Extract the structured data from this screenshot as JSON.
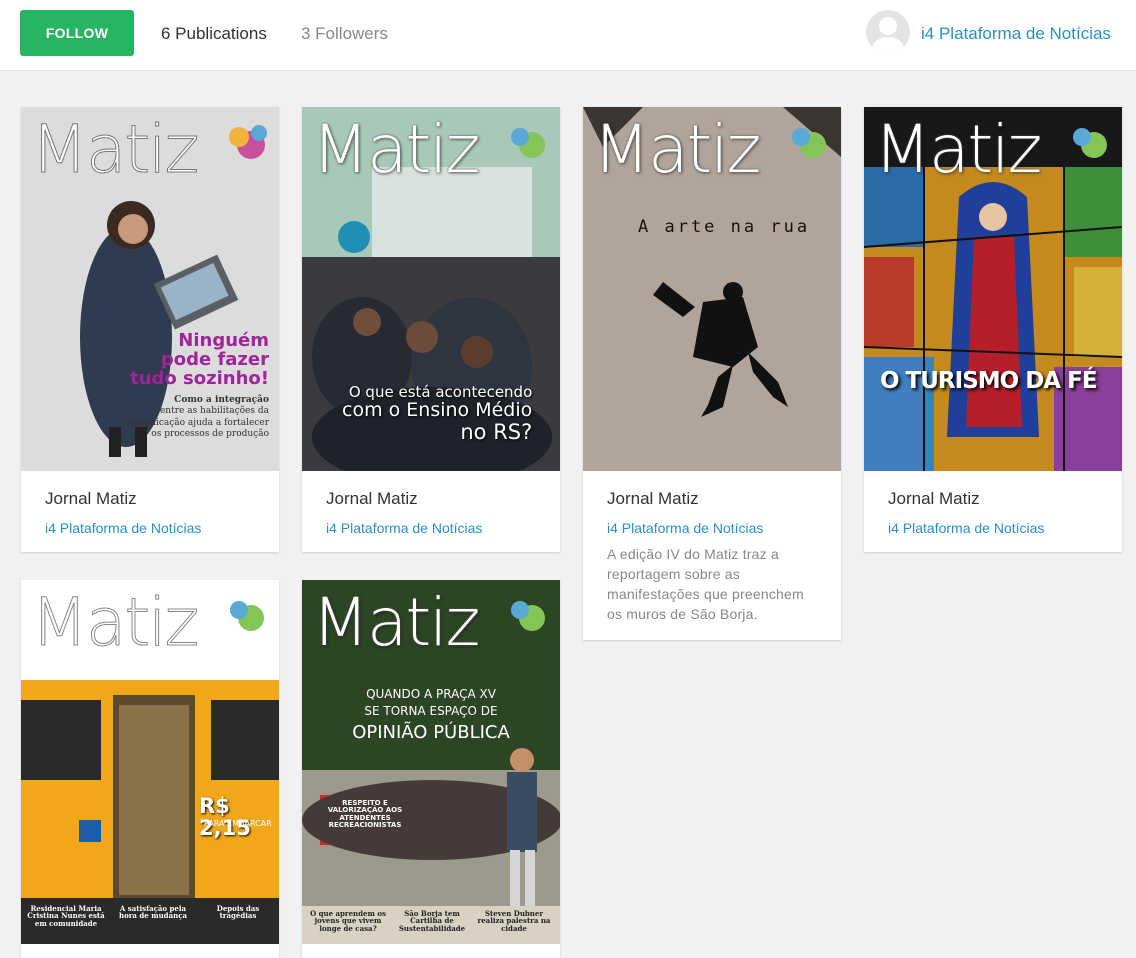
{
  "header": {
    "follow_label": "FOLLOW",
    "publications": "6 Publications",
    "followers": "3 Followers",
    "owner_name": "i4 Plataforma de Notícias"
  },
  "masthead": "Matiz",
  "cards": [
    {
      "title": "Jornal Matiz",
      "publisher": "i4 Plataforma de Notícias",
      "cover_text": [
        "Ninguém",
        "pode fazer",
        "tudo sozinho!",
        "Como a integração",
        "entre as habilitações da",
        "comunicação ajuda a fortalecer",
        "os processos de produção"
      ]
    },
    {
      "title": "Jornal Matiz",
      "publisher": "i4 Plataforma de Notícias",
      "cover_text": [
        "O que está acontecendo",
        "com o Ensino Médio",
        "no RS?"
      ]
    },
    {
      "title": "Jornal Matiz",
      "publisher": "i4 Plataforma de Notícias",
      "description": "A edição IV do Matiz traz a reportagem sobre as manifestações que preenchem os muros de São Borja.",
      "cover_text": [
        "A arte na rua"
      ]
    },
    {
      "title": "Jornal Matiz",
      "publisher": "i4 Plataforma de Notícias",
      "cover_text": [
        "O TURISMO DA FÉ"
      ]
    },
    {
      "title": "",
      "publisher": "",
      "cover_text": [
        "R$ 2,15",
        "PARA EMBARCAR",
        "Residencial Maria Cristina Nunes está em comunidade",
        "A satisfação pela hora de mudança",
        "Depois das tragédias"
      ]
    },
    {
      "title": "",
      "publisher": "",
      "cover_text": [
        "QUANDO A PRAÇA XV",
        "SE TORNA ESPAÇO DE",
        "OPINIÃO PÚBLICA",
        "RESPEITO E VALORIZAÇÃO AOS ATENDENTES RECREACIONISTAS",
        "O que aprendem os jovens que vivem longe de casa?",
        "São Borja tem Cartilha de Sustentabilidade",
        "Steven Dubner realiza palestra na cidade"
      ]
    }
  ]
}
